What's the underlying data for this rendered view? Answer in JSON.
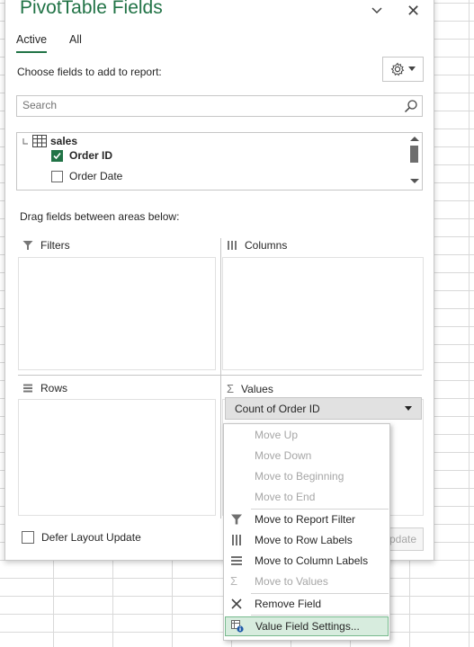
{
  "pane": {
    "title": "PivotTable Fields",
    "tabs": [
      {
        "label": "Active"
      },
      {
        "label": "All"
      }
    ],
    "choose_label": "Choose fields to add to report:",
    "search": {
      "placeholder": "Search",
      "value": ""
    },
    "fields": {
      "table_name": "sales",
      "items": [
        {
          "label": "Order ID",
          "checked": true
        },
        {
          "label": "Order Date",
          "checked": false
        }
      ]
    },
    "drag_label": "Drag fields between areas below:",
    "areas": {
      "filters": "Filters",
      "columns": "Columns",
      "rows": "Rows",
      "values": "Values"
    },
    "values_field": "Count of Order ID",
    "defer_label": "Defer Layout Update",
    "update_label": "Update",
    "update_visible": "pdate"
  },
  "context_menu": {
    "items": [
      {
        "label": "Move Up",
        "enabled": false,
        "icon": ""
      },
      {
        "label": "Move Down",
        "enabled": false,
        "icon": ""
      },
      {
        "label": "Move to Beginning",
        "enabled": false,
        "icon": ""
      },
      {
        "label": "Move to End",
        "enabled": false,
        "icon": ""
      },
      {
        "label": "Move to Report Filter",
        "enabled": true,
        "icon": "filter-icon"
      },
      {
        "label": "Move to Row Labels",
        "enabled": true,
        "icon": "row-labels-icon"
      },
      {
        "label": "Move to Column Labels",
        "enabled": true,
        "icon": "column-labels-icon"
      },
      {
        "label": "Move to Values",
        "enabled": false,
        "icon": "sigma-icon"
      },
      {
        "label": "Remove Field",
        "enabled": true,
        "icon": "remove-icon"
      },
      {
        "label": "Value Field Settings...",
        "enabled": true,
        "icon": "settings-info-icon",
        "highlighted": true
      }
    ]
  },
  "colors": {
    "accent": "#217346",
    "highlight": "#d7ecde",
    "disabled_text": "#a6a6a6"
  }
}
